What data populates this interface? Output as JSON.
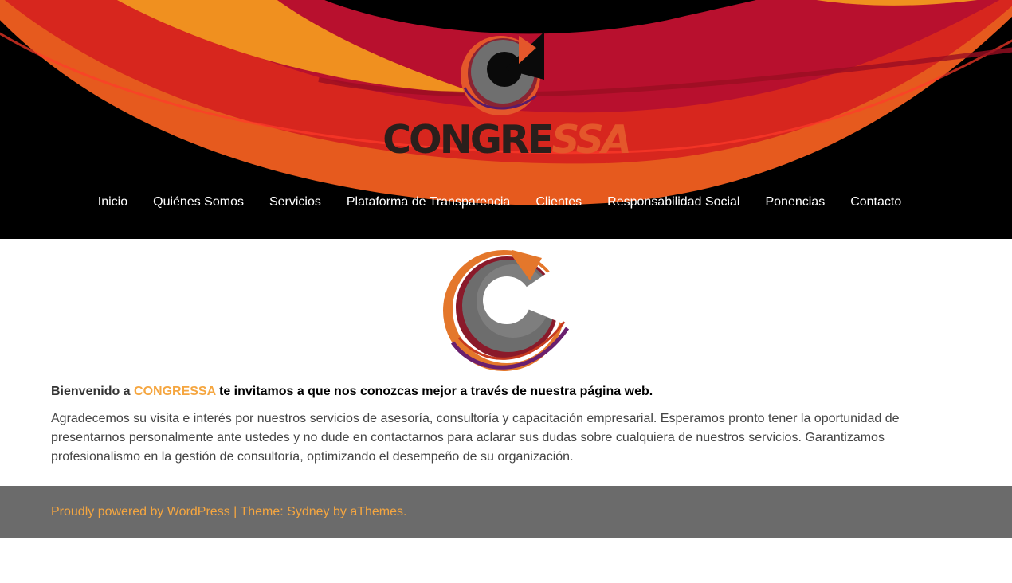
{
  "site": {
    "brand_prefix": "CONGRE",
    "brand_suffix": "SSA"
  },
  "nav": {
    "items": [
      {
        "label": "Inicio"
      },
      {
        "label": "Quiénes Somos"
      },
      {
        "label": "Servicios"
      },
      {
        "label": "Plataforma de Transparencia"
      },
      {
        "label": "Clientes"
      },
      {
        "label": "Responsabilidad Social"
      },
      {
        "label": "Ponencias"
      },
      {
        "label": "Contacto"
      }
    ]
  },
  "main": {
    "welcome_lead": "Bienvenido a ",
    "welcome_brand": "CONGRESSA",
    "welcome_rest": " te invitamos a que nos conozcas mejor a través de nuestra página web.",
    "body": "Agradecemos su visita e interés por nuestros servicios de asesoría, consultoría  y capacitación empresarial. Esperamos pronto tener la oportunidad de presentarnos personalmente ante ustedes y no dude en contactarnos para aclarar sus dudas sobre cualquiera de nuestros servicios. Garantizamos profesionalismo en la gestión de consultoría, optimizando el desempeño de su organización."
  },
  "footer": {
    "powered_link": "Proudly powered by WordPress",
    "separator": " | ",
    "theme_text": "Theme: Sydney by aThemes."
  },
  "colors": {
    "accent": "#f5a640",
    "header_bg": "#000000",
    "footer_bg": "#6b6b6b",
    "swoosh_orange": "#f0851f",
    "swoosh_red": "#d7261e",
    "swoosh_crimson": "#b8102e"
  },
  "icons": {
    "header_logo": "congressa-c-logo-icon",
    "content_logo": "congressa-c-logo-icon"
  }
}
